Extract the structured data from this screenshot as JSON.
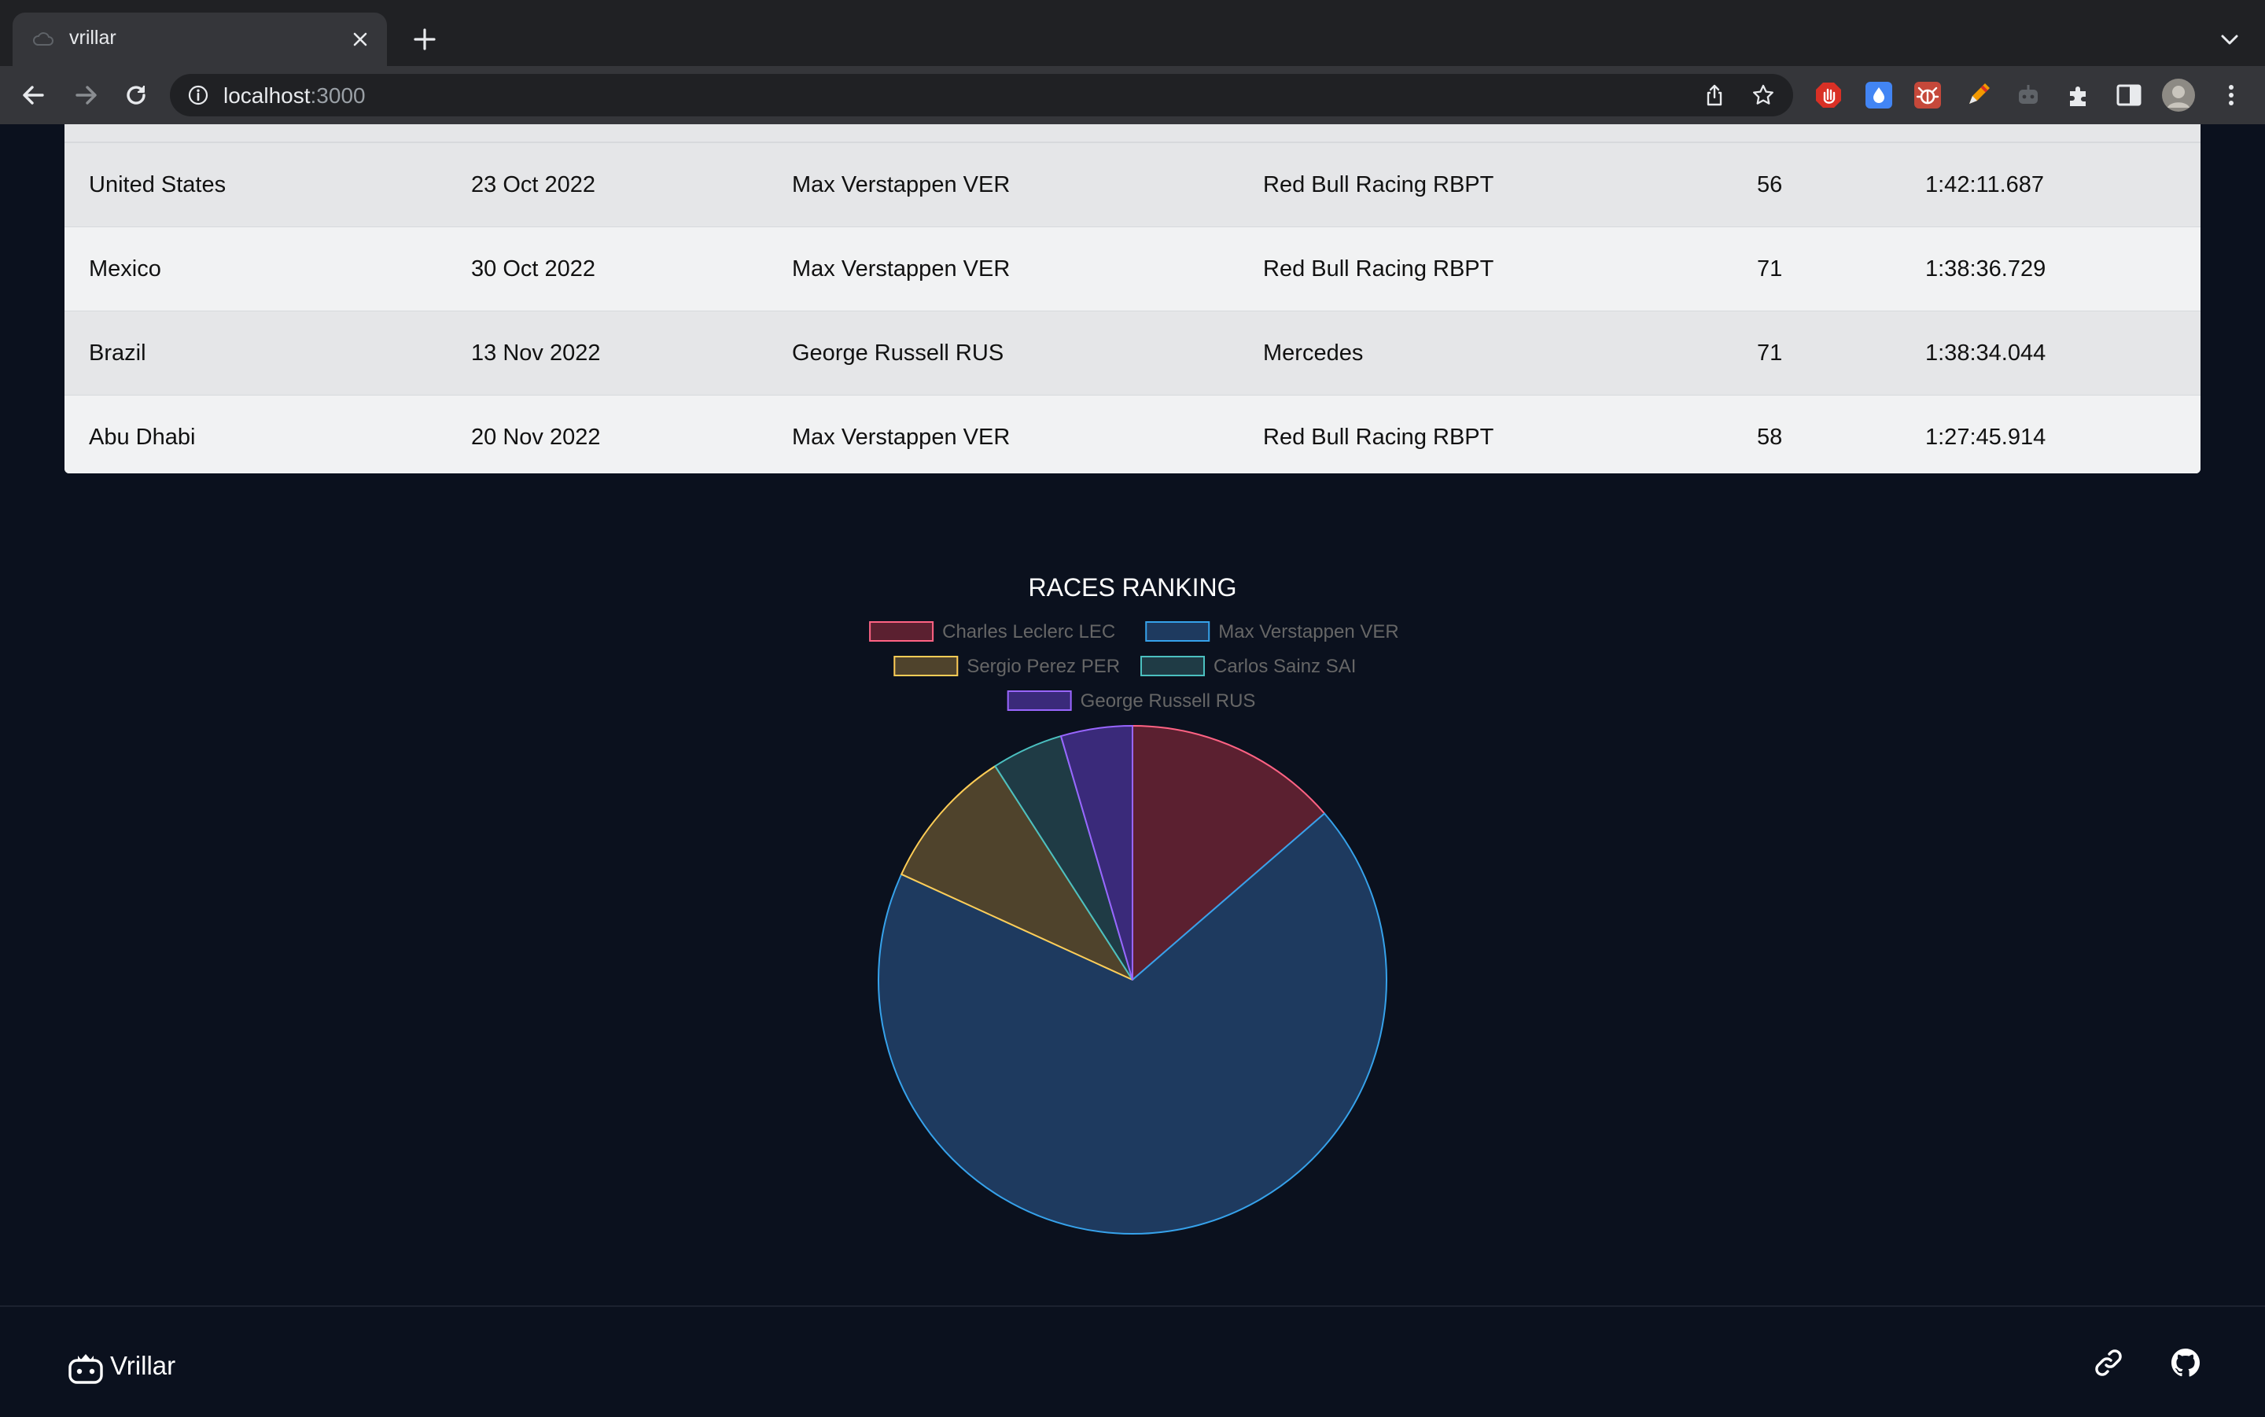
{
  "browser": {
    "tab_title": "vrillar",
    "url_host": "localhost",
    "url_port": ":3000"
  },
  "table": {
    "rows": [
      {
        "grand_prix": "United States",
        "date": "23 Oct 2022",
        "winner": "Max Verstappen VER",
        "car": "Red Bull Racing RBPT",
        "laps": "56",
        "time": "1:42:11.687"
      },
      {
        "grand_prix": "Mexico",
        "date": "30 Oct 2022",
        "winner": "Max Verstappen VER",
        "car": "Red Bull Racing RBPT",
        "laps": "71",
        "time": "1:38:36.729"
      },
      {
        "grand_prix": "Brazil",
        "date": "13 Nov 2022",
        "winner": "George Russell RUS",
        "car": "Mercedes",
        "laps": "71",
        "time": "1:38:34.044"
      },
      {
        "grand_prix": "Abu Dhabi",
        "date": "20 Nov 2022",
        "winner": "Max Verstappen VER",
        "car": "Red Bull Racing RBPT",
        "laps": "58",
        "time": "1:27:45.914"
      }
    ]
  },
  "chart_data": {
    "type": "pie",
    "title": "RACES RANKING",
    "legend_position": "top",
    "categories": [
      "Charles Leclerc LEC",
      "Max Verstappen VER",
      "Sergio Perez PER",
      "Carlos Sainz SAI",
      "George Russell RUS"
    ],
    "values": [
      3,
      15,
      2,
      1,
      1
    ],
    "colors": {
      "fill": [
        "#5b2030",
        "#1e3a5f",
        "#4f432c",
        "#1f3b45",
        "#3a2a7a"
      ],
      "stroke": [
        "#ff6384",
        "#36a2eb",
        "#ffcd56",
        "#4bc0c0",
        "#9966ff"
      ]
    }
  },
  "footer": {
    "brand": "Vrillar"
  },
  "colors": {
    "page_background": "#0b111e",
    "table_row_odd": "#e5e6e8",
    "table_row_even": "#f1f2f3"
  }
}
